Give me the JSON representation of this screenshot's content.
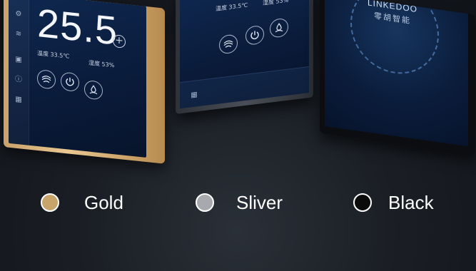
{
  "colors": {
    "gold": "#C7A56A",
    "silver": "#A7A9AE",
    "black": "#0B0B0C",
    "screen": "#0A1C3C"
  },
  "panel_gold": {
    "temperature": "25.5",
    "plus": "+",
    "temp_reading": "温度 33.5℃",
    "humidity_reading": "湿度 53%",
    "mode_button_icon": "fan-mode-icon",
    "power_button_icon": "power-icon",
    "dry_button_icon": "dehumidify-icon",
    "menu_icon": "grid-icon"
  },
  "panel_silver": {
    "temp_reading": "温度 33.5℃",
    "humidity_reading": "湿度 53%",
    "mode_button_icon": "fan-mode-icon",
    "power_button_icon": "power-icon",
    "dry_button_icon": "dehumidify-icon",
    "menu_icon": "grid-icon"
  },
  "panel_black": {
    "brand": "LINKEDOO",
    "brand_cn": "零胡智能"
  },
  "options": [
    {
      "label": "Gold"
    },
    {
      "label": "Sliver"
    },
    {
      "label": "Black"
    }
  ]
}
